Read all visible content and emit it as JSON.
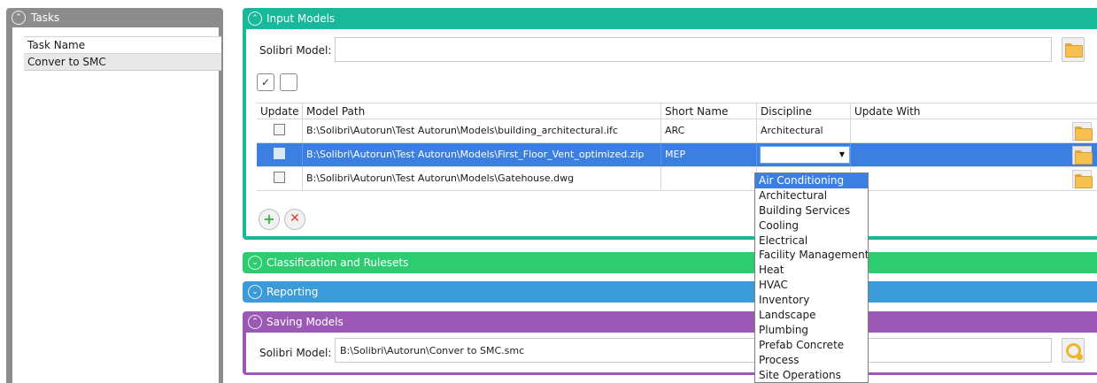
{
  "tasks_panel": {
    "title": "Tasks",
    "column_header": "Task Name",
    "rows": [
      "Conver to SMC"
    ]
  },
  "input_models": {
    "title": "Input Models",
    "solibri_model_label": "Solibri Model:",
    "solibri_model_value": "",
    "table": {
      "headers": {
        "update": "Update",
        "model_path": "Model Path",
        "short_name": "Short Name",
        "discipline": "Discipline",
        "update_with": "Update With"
      },
      "rows": [
        {
          "path": "B:\\Solibri\\Autorun\\Test Autorun\\Models\\building_architectural.ifc",
          "short_name": "ARC",
          "discipline": "Architectural",
          "update_with": "",
          "selected": false
        },
        {
          "path": "B:\\Solibri\\Autorun\\Test Autorun\\Models\\First_Floor_Vent_optimized.zip",
          "short_name": "MEP",
          "discipline": "",
          "update_with": "",
          "selected": true
        },
        {
          "path": "B:\\Solibri\\Autorun\\Test Autorun\\Models\\Gatehouse.dwg",
          "short_name": "",
          "discipline": "",
          "update_with": "",
          "selected": false
        }
      ]
    }
  },
  "discipline_dropdown": {
    "options": [
      "Air Conditioning",
      "Architectural",
      "Building Services",
      "Cooling",
      "Electrical",
      "Facility Management",
      "Heat",
      "HVAC",
      "Inventory",
      "Landscape",
      "Plumbing",
      "Prefab Concrete",
      "Process",
      "Site Operations"
    ],
    "highlighted": "Air Conditioning"
  },
  "classification": {
    "title": "Classification and Rulesets"
  },
  "reporting": {
    "title": "Reporting"
  },
  "saving_models": {
    "title": "Saving Models",
    "solibri_model_label": "Solibri Model:",
    "solibri_model_value": "B:\\Solibri\\Autorun\\Conver to SMC.smc"
  },
  "colors": {
    "tasks_panel": "#8c8c8c",
    "input_models": "#1ab89a",
    "classification": "#2ecc71",
    "reporting": "#3a9bd8",
    "saving_models": "#9b59b6",
    "selection": "#3b7fe0"
  },
  "icons": {
    "collapse": "chevron-up-icon",
    "expand": "chevron-down-icon",
    "browse": "folder-icon",
    "add": "plus-icon",
    "remove": "close-icon",
    "refresh": "refresh-icon",
    "check_all": "check-all-icon",
    "uncheck_all": "uncheck-all-icon"
  }
}
